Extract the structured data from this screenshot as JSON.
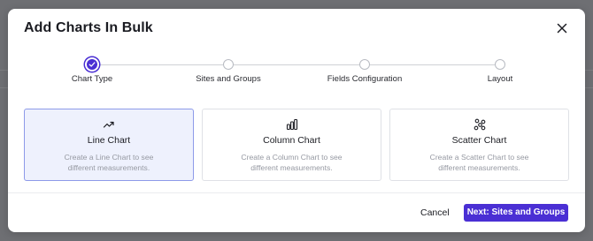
{
  "dialog": {
    "title": "Add Charts In Bulk",
    "close_icon": "close-icon"
  },
  "steps": [
    {
      "label": "Chart Type",
      "state": "completed"
    },
    {
      "label": "Sites and Groups",
      "state": "pending"
    },
    {
      "label": "Fields Configuration",
      "state": "pending"
    },
    {
      "label": "Layout",
      "state": "pending"
    }
  ],
  "chart_types": [
    {
      "icon": "trending-up-icon",
      "title": "Line Chart",
      "description": "Create a Line Chart to see different measurements.",
      "selected": true
    },
    {
      "icon": "bar-chart-icon",
      "title": "Column Chart",
      "description": "Create a Column Chart to see different measurements.",
      "selected": false
    },
    {
      "icon": "scatter-icon",
      "title": "Scatter Chart",
      "description": "Create a Scatter Chart to see different measurements.",
      "selected": false
    }
  ],
  "footer": {
    "cancel_label": "Cancel",
    "next_label": "Next: Sites and Groups"
  },
  "colors": {
    "accent": "#4a2fd4",
    "selected_card_bg": "#eef1fd",
    "selected_card_border": "#8d9ae9"
  }
}
